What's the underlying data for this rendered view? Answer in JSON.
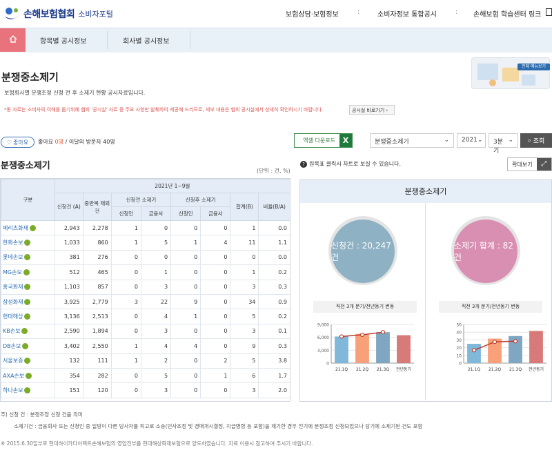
{
  "header": {
    "logo_text": "손해보험협회",
    "logo_sub": "소비자포털",
    "nav": [
      "보험상담·보험정보",
      "소비자정보 통합공시",
      "손해보험 학습센터 링크"
    ]
  },
  "navbar": {
    "tabs": [
      "항목별 공시정보",
      "회사별 공시정보"
    ]
  },
  "page": {
    "title": "분쟁중소제기",
    "desc": "보험회사별 분쟁조정 신청 전 후 소제기 현황 공시자료입니다.",
    "note": "*동 자료는 소비자의 이해를 돕기위해 협회 '공시실' 자료 중 주요 사항만 발췌하여 제공해 드리므로, 세부 내용은 협회 공시실에서 상세히 확인하시기 바랍니다.",
    "notice_button": "공시실 바로가기",
    "banner_btn": "전체 메뉴보기"
  },
  "toolbar": {
    "like_button": "좋아요",
    "like_info_prefix": "좋아요 ",
    "like_count": "0명",
    "like_info_suffix": " / 이달의 방문자 40명",
    "excel_label": "엑셀 다운로드",
    "excel_icon": "X",
    "select_item": "분쟁중소제기",
    "select_year": "2021",
    "select_quarter": "3분기",
    "search_label": "조회"
  },
  "table": {
    "section_title": "분쟁중소제기",
    "unit": "(단위 : 건, %)",
    "period": "2021년 1~9월",
    "headers": {
      "gubun": "구분",
      "apply": "신청건 (A)",
      "dup": "중반복 제외건",
      "before": "신청전 소제기",
      "after": "신청후 소제기",
      "sum": "합계(B)",
      "ratio": "비율(B/A)",
      "sub_applicant": "신청인",
      "sub_insurer": "금융사"
    },
    "rows": [
      [
        "메리츠화재",
        "2,943",
        "2,278",
        "1",
        "0",
        "0",
        "0",
        "1",
        "0.0"
      ],
      [
        "한화손보",
        "1,033",
        "860",
        "1",
        "5",
        "1",
        "4",
        "11",
        "1.1"
      ],
      [
        "롯데손보",
        "381",
        "276",
        "0",
        "0",
        "0",
        "0",
        "0",
        "0.0"
      ],
      [
        "MG손보",
        "512",
        "465",
        "0",
        "1",
        "0",
        "0",
        "1",
        "0.2"
      ],
      [
        "흥국화재",
        "1,103",
        "857",
        "0",
        "3",
        "0",
        "0",
        "3",
        "0.3"
      ],
      [
        "삼성화재",
        "3,925",
        "2,779",
        "3",
        "22",
        "9",
        "0",
        "34",
        "0.9"
      ],
      [
        "현대해상",
        "3,136",
        "2,513",
        "0",
        "4",
        "1",
        "0",
        "5",
        "0.2"
      ],
      [
        "KB손보",
        "2,590",
        "1,894",
        "0",
        "3",
        "0",
        "0",
        "3",
        "0.1"
      ],
      [
        "DB손보",
        "3,402",
        "2,550",
        "1",
        "4",
        "4",
        "0",
        "9",
        "0.3"
      ],
      [
        "서울보증",
        "132",
        "111",
        "1",
        "2",
        "0",
        "2",
        "5",
        "3.8"
      ],
      [
        "AXA손보",
        "354",
        "282",
        "0",
        "5",
        "0",
        "1",
        "6",
        "1.7"
      ],
      [
        "하나손보",
        "151",
        "120",
        "0",
        "3",
        "0",
        "0",
        "3",
        "2.0"
      ]
    ]
  },
  "chart_panel": {
    "info": "원목표 클릭시 차트로 보실 수 있습니다.",
    "zoom_label": "확대보기",
    "title": "분쟁중소제기",
    "left_circle": "신청건 : 20,247건",
    "right_circle": "소제기 합계 : 82건",
    "trend_label": "직전 3개 분기/전년동기 변동",
    "colors": {
      "left_circle": "#8fb1c4",
      "right_circle": "#d98fb2",
      "line": "#c0392b"
    }
  },
  "chart_data": [
    {
      "type": "bar",
      "categories": [
        "21.1Q",
        "21.2Q",
        "21.3Q",
        "전년동기"
      ],
      "values": [
        6200,
        6800,
        7200,
        6500
      ],
      "line_values": [
        6200,
        6600,
        7200
      ],
      "ylim": [
        0,
        9000
      ],
      "yticks": [
        "9,000",
        "6,000",
        "3,000",
        "0"
      ],
      "colors": [
        "#7fb8d8",
        "#f7a07a",
        "#7fa6c2",
        "#d97a7a"
      ]
    },
    {
      "type": "bar",
      "categories": [
        "21.1Q",
        "21.2Q",
        "21.3Q",
        "전년동기"
      ],
      "values": [
        30,
        38,
        42,
        50
      ],
      "line_values": [
        20,
        33,
        34
      ],
      "ylim": [
        0,
        60
      ],
      "yticks": [
        "50",
        "40",
        "30",
        "20",
        "10",
        "0"
      ],
      "colors": [
        "#7fb8d8",
        "#f7a07a",
        "#7fa6c2",
        "#d97a7a"
      ]
    }
  ],
  "footnote": {
    "line1": "주) 신청 건 : 분쟁조정 신청 건을 의미",
    "line2": "소제기건 : 금융회사 또는 신청인 중 일방이 다른 당사자를 피고로 소송(민사조정 및 경매개시결정, 지급명령 등 포함)을 제기한 경우 전기에 분쟁조정 신청되었으나 당기에 소제기된 건도 포함",
    "line3": "※ 2015.6.30일부로 현대하이카다이렉트손해보험의 영업전부를 현대해상화재보험으로 양도하였습니다. 자료 이용시 참고하여 주시기 바랍니다."
  }
}
